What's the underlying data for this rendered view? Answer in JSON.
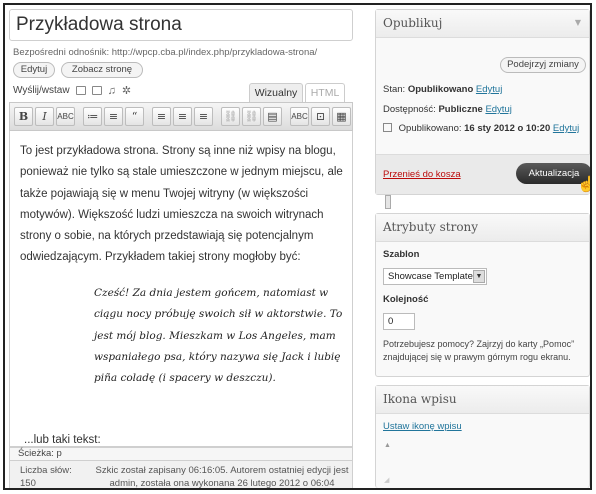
{
  "editor": {
    "title": "Przykładowa strona",
    "permalink": "Bezpośredni odnośnik: http://wpcp.cba.pl/index.php/przykladowa-strona/",
    "edit_permalink": "Edytuj",
    "view_page": "Zobacz stronę",
    "upload_insert": "Wyślij/wstaw",
    "tab_visual": "Wizualny",
    "tab_html": "HTML",
    "toolbar_buttons": [
      "B",
      "I",
      "ABC",
      "≔",
      "≡",
      "“",
      "≡",
      "≡",
      "≡",
      "⛓",
      "⛓",
      "▤",
      "ABC",
      "⊡",
      "▦"
    ],
    "paragraph": "To jest przykładowa strona. Strony są inne niż wpisy na blogu, ponieważ nie tylko są stale umieszczone w jednym miejscu, ale także pojawiają się w menu Twojej witryny (w większości motywów). Większość ludzi umieszcza na swoich witrynach strony o sobie, na których przedstawiają się potencjalnym odwiedzającym. Przykładem takiej strony mogłoby być:",
    "quote": "Cześć! Za dnia jestem gońcem, natomiast w ciągu nocy próbuję swoich sił w aktorstwie. To jest mój blog. Mieszkam w Los Angeles, mam wspaniałego psa, który nazywa się Jack i lubię piña coladę (i spacery w deszczu).",
    "after_quote": "...lub taki tekst:",
    "path_label": "Ścieżka: p",
    "word_count_label": "Liczba słów: 150",
    "save_status": "Szkic został zapisany 06:16:05. Autorem ostatniej edycji jest admin, została ona wykonana 26 lutego 2012 o 06:04"
  },
  "publish": {
    "title": "Opublikuj",
    "preview_button": "Podejrzyj zmiany",
    "status_label": "Stan:",
    "status_value": "Opublikowano",
    "visibility_label": "Dostępność:",
    "visibility_value": "Publiczne",
    "published_label": "Opublikowano:",
    "published_value": "16 sty 2012 o 10:20",
    "edit_link": "Edytuj",
    "trash_link": "Przenieś do kosza",
    "update_button": "Aktualizacja"
  },
  "attributes": {
    "title": "Atrybuty strony",
    "template_label": "Szablon",
    "template_value": "Showcase Template",
    "order_label": "Kolejność",
    "order_value": "0",
    "help_text": "Potrzebujesz pomocy? Zajrzyj do karty „Pomoc” znajdującej się w prawym górnym rogu ekranu."
  },
  "featured_image": {
    "title": "Ikona wpisu",
    "set_link": "Ustaw ikonę wpisu"
  },
  "colors": {
    "link": "#21759b",
    "trash": "#bc0b0b",
    "update_button": "#3a3a3a"
  }
}
